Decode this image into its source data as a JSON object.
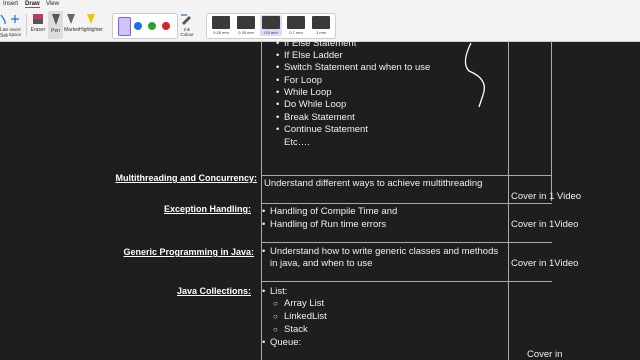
{
  "ribbon": {
    "tabs": [
      "Insert",
      "Draw",
      "View"
    ],
    "active_tab": "Draw",
    "tools": {
      "lasso": "Lasso Select",
      "insert_space": "Insert Space",
      "eraser": "Eraser",
      "pen": "Pen",
      "marker": "Marker",
      "highlighter": "Highlighter",
      "ink_colour": "Ink Colour"
    },
    "colors": [
      "#1f6fe8",
      "#2ca02c",
      "#d62728"
    ],
    "strokes": [
      "0.25 mm",
      "0.35 mm",
      "0.5 mm",
      "0.7 mm",
      "1 mm"
    ],
    "selected_stroke": "0.5 mm"
  },
  "control_flow": {
    "items": [
      "If Else Statement",
      "If Else Ladder",
      "Switch Statement and when to use",
      "For Loop",
      "While Loop",
      "Do While Loop",
      "Break Statement",
      "Continue Statement"
    ],
    "etc": "Etc…."
  },
  "rows": [
    {
      "heading": "Multithreading and Concurrency:",
      "lines": [
        "Understand different ways to achieve multithreading"
      ],
      "cover": "Cover in 1 Video"
    },
    {
      "heading": "Exception Handling:",
      "lines": [
        "Handling of Compile Time and",
        "Handling of Run time errors"
      ],
      "cover": "Cover in 1Video"
    },
    {
      "heading": "Generic Programming in Java:",
      "lines": [
        "Understand how to write generic classes and methods",
        "in java, and when to use"
      ],
      "cover": "Cover in 1Video"
    },
    {
      "heading": "Java Collections:",
      "list_label": "List:",
      "list_items": [
        "Array List",
        "LinkedList",
        "Stack"
      ],
      "queue_label": "Queue:",
      "cover": "Cover in"
    }
  ]
}
